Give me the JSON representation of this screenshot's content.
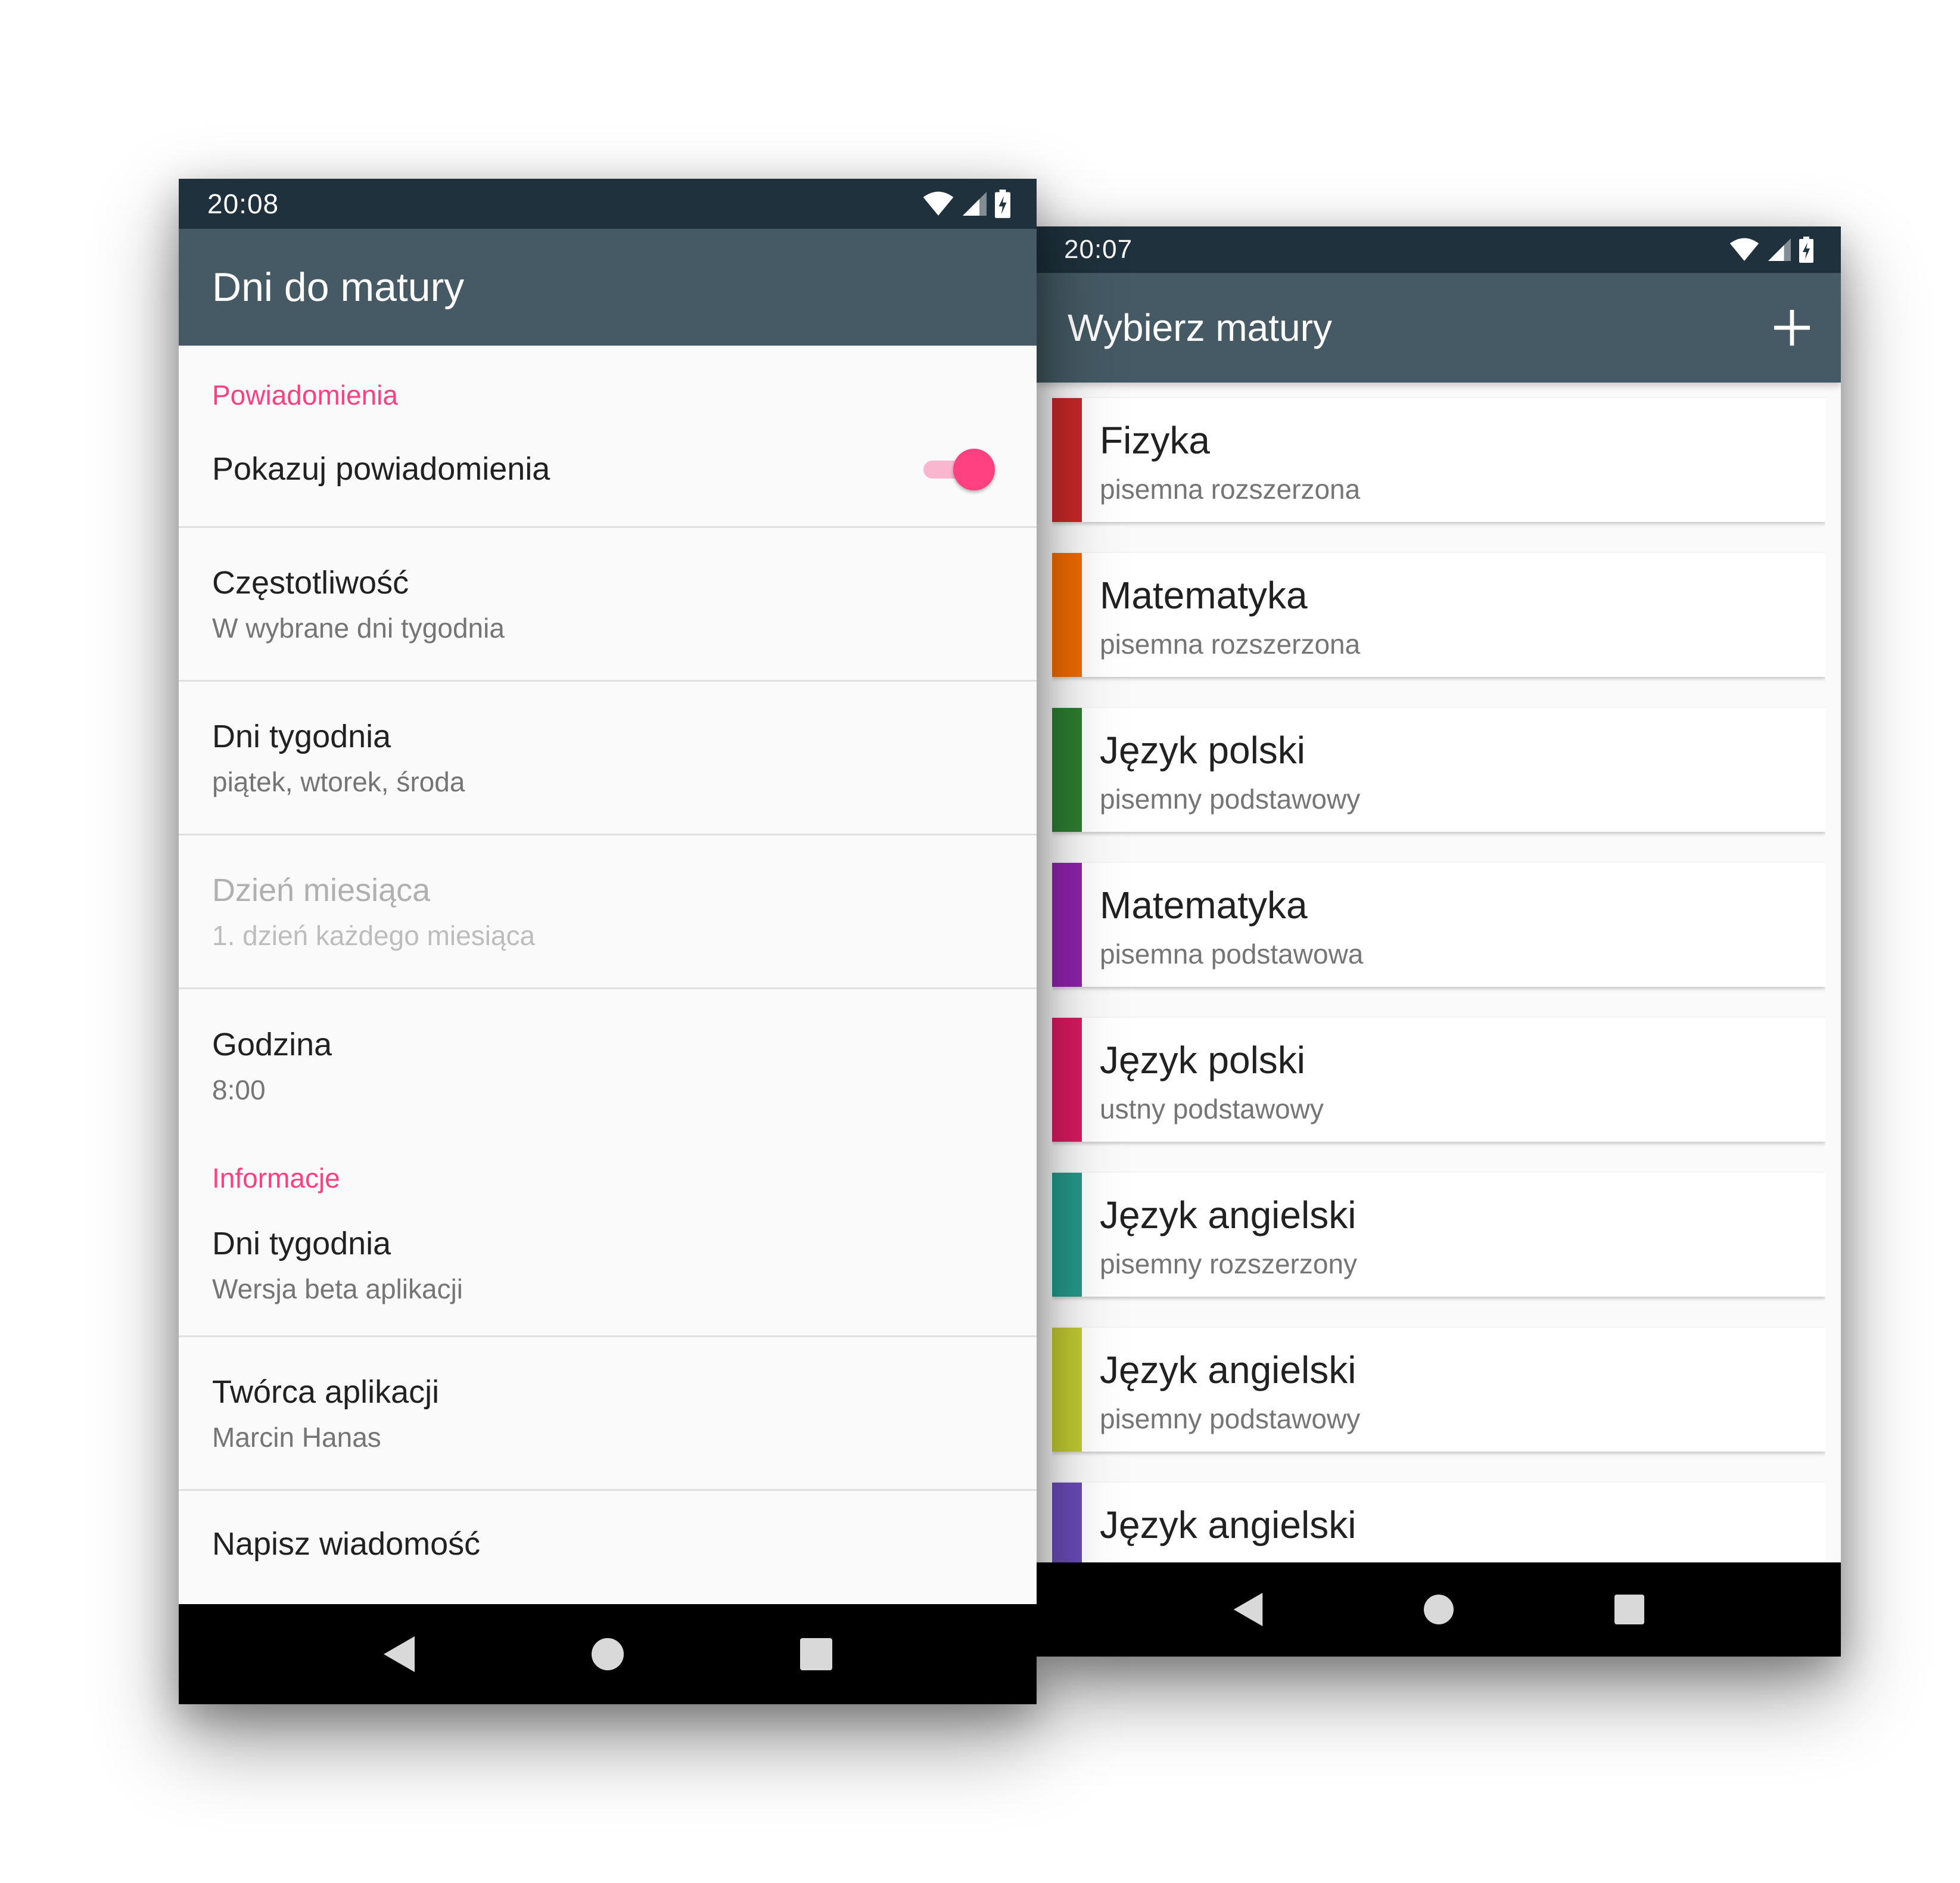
{
  "left_screen": {
    "status_time": "20:08",
    "app_title": "Dni do matury",
    "sections": [
      {
        "header": "Powiadomienia",
        "toggle": {
          "title": "Pokazuj powiadomienia",
          "on": true
        },
        "items": [
          {
            "title": "Częstotliwość",
            "summary": "W wybrane dni tygodnia",
            "enabled": true
          },
          {
            "title": "Dni tygodnia",
            "summary": "piątek, wtorek, środa",
            "enabled": true
          },
          {
            "title": "Dzień miesiąca",
            "summary": "1. dzień każdego miesiąca",
            "enabled": false
          },
          {
            "title": "Godzina",
            "summary": "8:00",
            "enabled": true
          }
        ]
      },
      {
        "header": "Informacje",
        "items": [
          {
            "title": "Dni tygodnia",
            "summary": "Wersja beta aplikacji"
          },
          {
            "title": "Twórca aplikacji",
            "summary": "Marcin Hanas"
          },
          {
            "title": "Napisz wiadomość",
            "summary": ""
          }
        ]
      }
    ]
  },
  "right_screen": {
    "status_time": "20:07",
    "app_title": "Wybierz matury",
    "add_icon": "plus-icon",
    "exams": [
      {
        "name": "Fizyka",
        "type": "pisemna rozszerzona",
        "color": "#c62828"
      },
      {
        "name": "Matematyka",
        "type": "pisemna rozszerzona",
        "color": "#ef6c00"
      },
      {
        "name": "Język polski",
        "type": "pisemny podstawowy",
        "color": "#2e7d32"
      },
      {
        "name": "Matematyka",
        "type": "pisemna podstawowa",
        "color": "#8e24aa"
      },
      {
        "name": "Język polski",
        "type": "ustny podstawowy",
        "color": "#d81b60"
      },
      {
        "name": "Język angielski",
        "type": "pisemny rozszerzony",
        "color": "#26998b"
      },
      {
        "name": "Język angielski",
        "type": "pisemny podstawowy",
        "color": "#c0ca33"
      },
      {
        "name": "Język angielski",
        "type": "",
        "color": "#6a4bb5"
      }
    ]
  },
  "colors": {
    "status_bar": "#1f313c",
    "app_bar": "#455a64",
    "accent": "#ff4081",
    "nav_bar": "#000000"
  },
  "icons": [
    "wifi-icon",
    "cell-signal-icon",
    "battery-charging-icon",
    "back-icon",
    "home-icon",
    "recents-icon",
    "plus-icon"
  ]
}
